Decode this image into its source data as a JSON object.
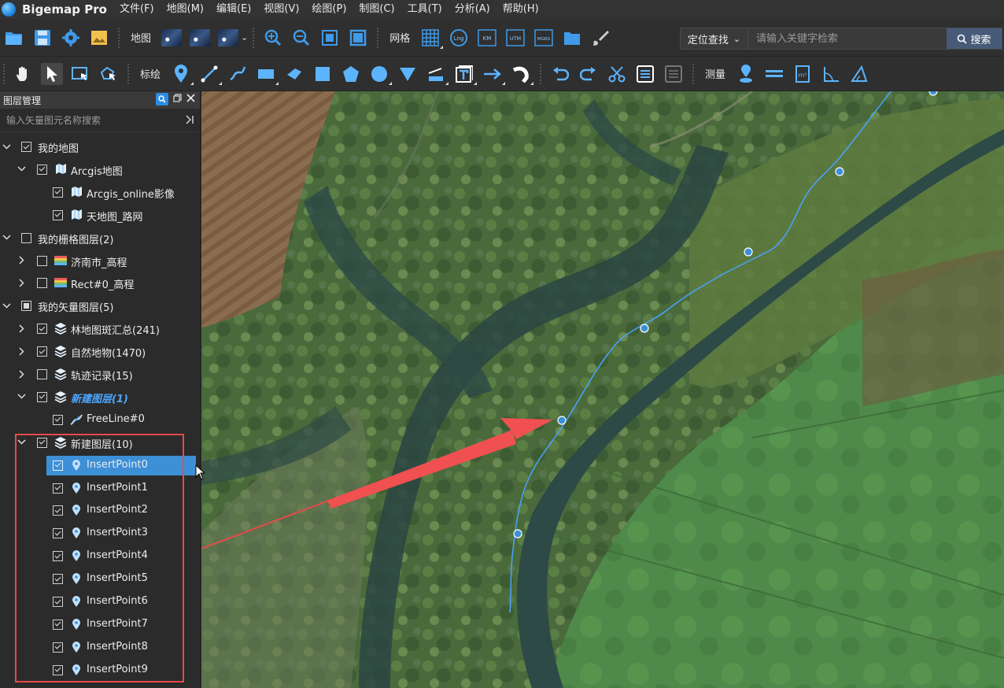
{
  "app": {
    "title": "Bigemap Pro"
  },
  "menu": [
    "文件(F)",
    "地图(M)",
    "编辑(E)",
    "视图(V)",
    "绘图(P)",
    "制图(C)",
    "工具(T)",
    "分析(A)",
    "帮助(H)"
  ],
  "toolbar1": {
    "map_label": "地图",
    "grid_label": "网格",
    "search_mode": "定位查找",
    "search_placeholder": "请输入关键字检索",
    "search_button": "搜索",
    "grid_badges": [
      "Lng",
      "KM",
      "UTM",
      "MGRS"
    ]
  },
  "toolbar2": {
    "draw_label": "标绘",
    "measure_label": "测量",
    "icons": [
      "hand-pan-icon",
      "pointer-select-icon",
      "rect-select-icon",
      "lasso-select-icon",
      "marker-icon",
      "polyline-icon",
      "freeline-icon",
      "rectangle-icon",
      "polygon-arrow-icon",
      "square-icon",
      "pentagon-icon",
      "circle-icon",
      "sector-icon",
      "ruler-area-icon",
      "text-icon",
      "arrow-icon",
      "curve-arrow-icon",
      "undo-icon",
      "redo-icon",
      "cut-icon",
      "layer-icon",
      "layer2-icon",
      "measure-point-icon",
      "measure-length-icon",
      "measure-area-icon",
      "measure-angle-icon",
      "measure-triangle-icon"
    ]
  },
  "panel": {
    "title": "图层管理",
    "filter_placeholder": "输入矢量图元名称搜索",
    "rows": [
      {
        "label": "我的地图",
        "level": 0,
        "arrow": "down",
        "check": "checked",
        "icon": ""
      },
      {
        "label": "Arcgis地图",
        "level": 1,
        "arrow": "down",
        "check": "checked",
        "icon": "map"
      },
      {
        "label": "Arcgis_online影像",
        "level": 2,
        "arrow": "",
        "check": "checked",
        "icon": "map"
      },
      {
        "label": "天地图_路网",
        "level": 2,
        "arrow": "",
        "check": "checked",
        "icon": "map"
      },
      {
        "label": "我的栅格图层(2)",
        "level": 0,
        "arrow": "down",
        "check": "unchecked",
        "icon": ""
      },
      {
        "label": "济南市_高程",
        "level": 1,
        "arrow": "right",
        "check": "unchecked",
        "icon": "raster"
      },
      {
        "label": "Rect#0_高程",
        "level": 1,
        "arrow": "right",
        "check": "unchecked",
        "icon": "raster"
      },
      {
        "label": "我的矢量图层(5)",
        "level": 0,
        "arrow": "down",
        "check": "partial",
        "icon": ""
      },
      {
        "label": "林地图斑汇总(241)",
        "level": 1,
        "arrow": "right",
        "check": "checked",
        "icon": "layers"
      },
      {
        "label": "自然地物(1470)",
        "level": 1,
        "arrow": "right",
        "check": "checked",
        "icon": "layers"
      },
      {
        "label": "轨迹记录(15)",
        "level": 1,
        "arrow": "right",
        "check": "unchecked",
        "icon": "layers"
      },
      {
        "label": "新建图层(1)",
        "level": 1,
        "arrow": "down",
        "check": "checked",
        "icon": "layers",
        "style": "active"
      },
      {
        "label": "FreeLine#0",
        "level": 2,
        "arrow": "",
        "check": "checked",
        "icon": "freeline"
      },
      {
        "label": "新建图层(10)",
        "level": 1,
        "arrow": "down",
        "check": "checked",
        "icon": "layers"
      },
      {
        "label": "InsertPoint0",
        "level": 2,
        "arrow": "",
        "check": "checked",
        "icon": "pin",
        "selected": true
      },
      {
        "label": "InsertPoint1",
        "level": 2,
        "arrow": "",
        "check": "checked",
        "icon": "pin"
      },
      {
        "label": "InsertPoint2",
        "level": 2,
        "arrow": "",
        "check": "checked",
        "icon": "pin"
      },
      {
        "label": "InsertPoint3",
        "level": 2,
        "arrow": "",
        "check": "checked",
        "icon": "pin"
      },
      {
        "label": "InsertPoint4",
        "level": 2,
        "arrow": "",
        "check": "checked",
        "icon": "pin"
      },
      {
        "label": "InsertPoint5",
        "level": 2,
        "arrow": "",
        "check": "checked",
        "icon": "pin"
      },
      {
        "label": "InsertPoint6",
        "level": 2,
        "arrow": "",
        "check": "checked",
        "icon": "pin"
      },
      {
        "label": "InsertPoint7",
        "level": 2,
        "arrow": "",
        "check": "checked",
        "icon": "pin"
      },
      {
        "label": "InsertPoint8",
        "level": 2,
        "arrow": "",
        "check": "checked",
        "icon": "pin"
      },
      {
        "label": "InsertPoint9",
        "level": 2,
        "arrow": "",
        "check": "checked",
        "icon": "pin"
      }
    ]
  },
  "colors": {
    "accent": "#3d8fd6",
    "annotation_red": "#e84a4a",
    "line_blue": "#4aa3ff",
    "active_layer_text": "#4da6ff"
  }
}
